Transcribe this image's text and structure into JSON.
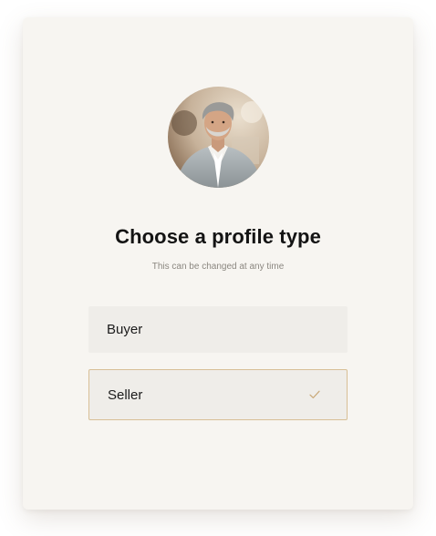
{
  "heading": {
    "title": "Choose a profile type",
    "subtitle": "This can be changed at any time"
  },
  "avatar": {
    "description_icon": "user-avatar-photo"
  },
  "options": [
    {
      "label": "Buyer",
      "selected": false
    },
    {
      "label": "Seller",
      "selected": true
    }
  ],
  "colors": {
    "card_background": "#f7f5f1",
    "option_background": "#efede9",
    "selected_border": "#d8bf96",
    "check_color": "#c9a877",
    "title_color": "#141414",
    "subtitle_color": "#8b8780"
  },
  "icons": {
    "selected_indicator": "check-icon"
  }
}
